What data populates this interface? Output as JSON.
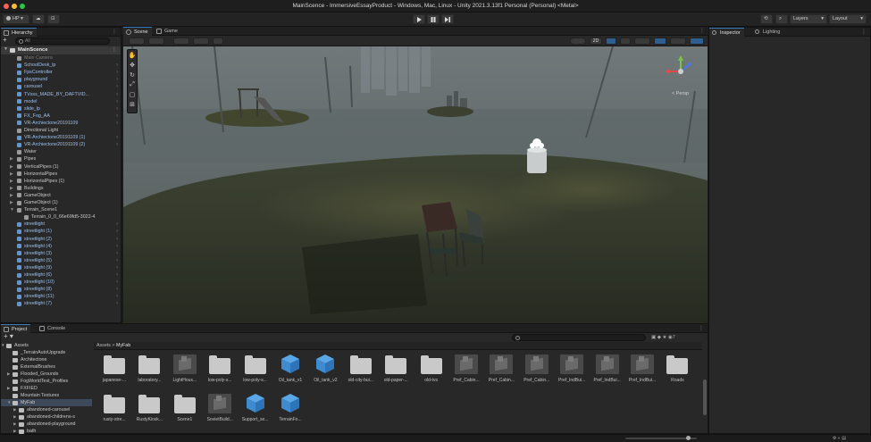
{
  "window": {
    "title": "MainScence - ImmersiveEssayProduct - Windows, Mac, Linux - Unity 2021.3.13f1 Personal (Personal) <Metal>"
  },
  "toolbar": {
    "account_label": "HP",
    "layers_label": "Layers",
    "layout_label": "Layout"
  },
  "hierarchy": {
    "tab_label": "Hierarchy",
    "search_placeholder": "All",
    "scene_name": "MainScence",
    "items": [
      {
        "label": "Main Camera",
        "indent": 1,
        "kind": "grey",
        "expand": false,
        "dim": true
      },
      {
        "label": "SchoolDesk_lp",
        "indent": 1,
        "kind": "prefab",
        "expand": true
      },
      {
        "label": "FpsController",
        "indent": 1,
        "kind": "prefab",
        "expand": true
      },
      {
        "label": "playground",
        "indent": 1,
        "kind": "prefab",
        "expand": true
      },
      {
        "label": "carousel",
        "indent": 1,
        "kind": "prefab",
        "expand": true
      },
      {
        "label": "TVsss_MADE_BY_DAFTVID...",
        "indent": 1,
        "kind": "prefab",
        "expand": true
      },
      {
        "label": "model",
        "indent": 1,
        "kind": "prefab",
        "expand": true
      },
      {
        "label": "slide_lp",
        "indent": 1,
        "kind": "prefab",
        "expand": true
      },
      {
        "label": "FX_Fog_AA",
        "indent": 1,
        "kind": "prefab",
        "expand": true
      },
      {
        "label": "VR-Archiectone20191109",
        "indent": 1,
        "kind": "prefab",
        "expand": true
      },
      {
        "label": "Directional Light",
        "indent": 1,
        "kind": "grey",
        "expand": false
      },
      {
        "label": "VR-Archiectone20191109 (1)",
        "indent": 1,
        "kind": "prefab",
        "expand": true
      },
      {
        "label": "VR-Archiectone20191109 (2)",
        "indent": 1,
        "kind": "prefab",
        "expand": true
      },
      {
        "label": "Water",
        "indent": 1,
        "kind": "grey",
        "expand": false
      },
      {
        "label": "Pipes",
        "indent": 1,
        "kind": "grey",
        "tri": true
      },
      {
        "label": "VerticalPipes (1)",
        "indent": 1,
        "kind": "grey",
        "tri": true
      },
      {
        "label": "HorizontalPipes",
        "indent": 1,
        "kind": "grey",
        "tri": true
      },
      {
        "label": "HorizontalPipes (1)",
        "indent": 1,
        "kind": "grey",
        "tri": true
      },
      {
        "label": "Buildings",
        "indent": 1,
        "kind": "grey",
        "tri": true
      },
      {
        "label": "GameObject",
        "indent": 1,
        "kind": "grey",
        "tri": true
      },
      {
        "label": "GameObject (1)",
        "indent": 1,
        "kind": "grey",
        "tri": true
      },
      {
        "label": "Terrain_Scene1",
        "indent": 1,
        "kind": "grey",
        "tri": true,
        "open": true
      },
      {
        "label": "Terrain_0_0_66e69fd5-3022-4",
        "indent": 2,
        "kind": "grey",
        "expand": false
      },
      {
        "label": "streetlight",
        "indent": 1,
        "kind": "prefab",
        "expand": true
      },
      {
        "label": "streetlight (1)",
        "indent": 1,
        "kind": "prefab",
        "expand": true
      },
      {
        "label": "streetlight (2)",
        "indent": 1,
        "kind": "prefab",
        "expand": true
      },
      {
        "label": "streetlight (4)",
        "indent": 1,
        "kind": "prefab",
        "expand": true
      },
      {
        "label": "streetlight (3)",
        "indent": 1,
        "kind": "prefab",
        "expand": true
      },
      {
        "label": "streetlight (5)",
        "indent": 1,
        "kind": "prefab",
        "expand": true
      },
      {
        "label": "streetlight (9)",
        "indent": 1,
        "kind": "prefab",
        "expand": true
      },
      {
        "label": "streetlight (6)",
        "indent": 1,
        "kind": "prefab",
        "expand": true
      },
      {
        "label": "streetlight (10)",
        "indent": 1,
        "kind": "prefab",
        "expand": true
      },
      {
        "label": "streetlight (8)",
        "indent": 1,
        "kind": "prefab",
        "expand": true
      },
      {
        "label": "streetlight (11)",
        "indent": 1,
        "kind": "prefab",
        "expand": true
      },
      {
        "label": "streetlight (7)",
        "indent": 1,
        "kind": "prefab",
        "expand": true
      }
    ]
  },
  "scene": {
    "tab_scene": "Scene",
    "tab_game": "Game",
    "toggle_2d": "2D",
    "persp_label": "< Persp"
  },
  "inspector": {
    "tab_inspector": "Inspector",
    "tab_lighting": "Lighting"
  },
  "project": {
    "tab_project": "Project",
    "tab_console": "Console",
    "breadcrumb_root": "Assets",
    "breadcrumb_sep": ">",
    "breadcrumb_current": "MyFab",
    "count": "7",
    "tree": [
      {
        "label": "Assets",
        "indent": 0,
        "open": true
      },
      {
        "label": "_TerrainAutoUpgrade",
        "indent": 1
      },
      {
        "label": "Architectone",
        "indent": 1
      },
      {
        "label": "ExternalBrushes",
        "indent": 1
      },
      {
        "label": "Flooded_Grounds",
        "indent": 1,
        "tri": true
      },
      {
        "label": "FogWorldTest_Profiles",
        "indent": 1
      },
      {
        "label": "FXFIED",
        "indent": 1,
        "tri": true
      },
      {
        "label": "Mountain Textures",
        "indent": 1
      },
      {
        "label": "MyFab",
        "indent": 1,
        "tri": true,
        "open": true,
        "selected": true
      },
      {
        "label": "abandoned-carousel",
        "indent": 2,
        "tri": true
      },
      {
        "label": "abandoned-childrens-s",
        "indent": 2,
        "tri": true
      },
      {
        "label": "abandoned-playground",
        "indent": 2,
        "tri": true
      },
      {
        "label": "bath",
        "indent": 2,
        "tri": true
      }
    ],
    "assets_row1": [
      {
        "label": "japanese-...",
        "type": "folder"
      },
      {
        "label": "laboratory...",
        "type": "folder"
      },
      {
        "label": "LightHous...",
        "type": "model"
      },
      {
        "label": "low-poly-s...",
        "type": "folder"
      },
      {
        "label": "low-poly-s...",
        "type": "folder"
      },
      {
        "label": "Oil_tank_v1",
        "type": "prefab"
      },
      {
        "label": "Oil_tank_v2",
        "type": "prefab"
      },
      {
        "label": "old-city-bui...",
        "type": "folder"
      },
      {
        "label": "old-paper-...",
        "type": "folder"
      },
      {
        "label": "old-tvs",
        "type": "folder"
      },
      {
        "label": "Pref_Cabin...",
        "type": "model"
      },
      {
        "label": "Pref_Cabin...",
        "type": "model"
      },
      {
        "label": "Pref_Cabin...",
        "type": "model"
      },
      {
        "label": "Pref_IndBui...",
        "type": "model"
      },
      {
        "label": "Pref_IndBui...",
        "type": "model"
      },
      {
        "label": "Pref_IndBui...",
        "type": "model"
      },
      {
        "label": "Roads",
        "type": "folder"
      }
    ],
    "assets_row2": [
      {
        "label": "rusty-stre...",
        "type": "folder"
      },
      {
        "label": "RustyKiosk...",
        "type": "folder"
      },
      {
        "label": "Scene1",
        "type": "folder"
      },
      {
        "label": "SovietBuild...",
        "type": "model"
      },
      {
        "label": "Support_se...",
        "type": "prefab"
      },
      {
        "label": "TerrainFo...",
        "type": "prefab"
      }
    ]
  },
  "colors": {
    "accent": "#3a79bb",
    "prefab_blue": "#5aa7e8",
    "hierarchy_text": "#9cc0f0"
  }
}
